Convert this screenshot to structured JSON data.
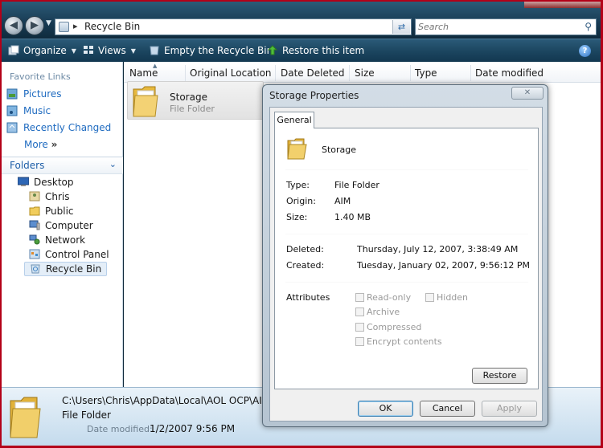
{
  "address_bar": {
    "path": "Recycle Bin",
    "search_placeholder": "Search"
  },
  "toolbar": {
    "organize": "Organize",
    "views": "Views",
    "empty": "Empty the Recycle Bin",
    "restore": "Restore this item"
  },
  "favorites": {
    "title": "Favorite Links",
    "items": [
      "Pictures",
      "Music",
      "Recently Changed"
    ],
    "more": "More"
  },
  "folders": {
    "title": "Folders",
    "tree": [
      "Desktop",
      "Chris",
      "Public",
      "Computer",
      "Network",
      "Control Panel",
      "Recycle Bin"
    ]
  },
  "file_list": {
    "columns": [
      "Name",
      "Original Location",
      "Date Deleted",
      "Size",
      "Type",
      "Date modified"
    ],
    "item": {
      "name": "Storage",
      "type": "File Folder"
    }
  },
  "details": {
    "path": "C:\\Users\\Chris\\AppData\\Local\\AOL OCP\\AIM",
    "type": "File Folder",
    "date_label": "Date modified:",
    "date_value": "1/2/2007 9:56 PM"
  },
  "dialog": {
    "title": "Storage Properties",
    "tab": "General",
    "name": "Storage",
    "labels": {
      "type": "Type:",
      "origin": "Origin:",
      "size": "Size:",
      "deleted": "Deleted:",
      "created": "Created:",
      "attributes": "Attributes"
    },
    "values": {
      "type": "File Folder",
      "origin": "AIM",
      "size": "1.40 MB",
      "deleted": "Thursday, July 12, 2007, 3:38:49 AM",
      "created": "Tuesday, January 02, 2007, 9:56:12 PM"
    },
    "attributes": {
      "read_only": "Read-only",
      "hidden": "Hidden",
      "archive": "Archive",
      "compressed": "Compressed",
      "encrypt": "Encrypt contents"
    },
    "buttons": {
      "restore": "Restore",
      "ok": "OK",
      "cancel": "Cancel",
      "apply": "Apply"
    }
  }
}
